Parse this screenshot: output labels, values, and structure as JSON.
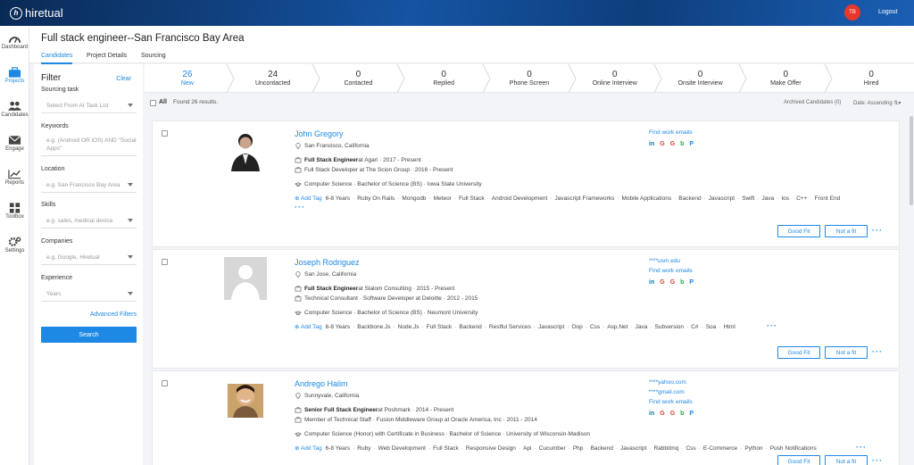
{
  "app": {
    "name": "hiretual",
    "avatar_initials": "TB",
    "logout": "Logout"
  },
  "nav": [
    {
      "label": "Dashboard",
      "icon": "dashboard-icon"
    },
    {
      "label": "Projects",
      "icon": "briefcase-icon"
    },
    {
      "label": "Candidates",
      "icon": "people-icon"
    },
    {
      "label": "Engage",
      "icon": "envelope-icon"
    },
    {
      "label": "Reports",
      "icon": "chart-icon"
    },
    {
      "label": "Toolbox",
      "icon": "grid-icon"
    },
    {
      "label": "Settings",
      "icon": "gear-icon"
    }
  ],
  "project": {
    "title": "Full stack engineer--San Francisco Bay Area",
    "tabs": [
      "Candidates",
      "Project Details",
      "Sourcing"
    ]
  },
  "filter": {
    "title": "Filter",
    "clear": "Clear",
    "fields": [
      {
        "label": "Sourcing task",
        "placeholder": "Select From AI Task List",
        "select": true
      },
      {
        "label": "Keywords",
        "placeholder": "e.g. (Android OR iOS) AND \"Social Apps\"",
        "select": false
      },
      {
        "label": "Location",
        "placeholder": "e.g. San Francisco Bay Area",
        "select": true
      },
      {
        "label": "Skills",
        "placeholder": "e.g. sales, medical device",
        "select": true
      },
      {
        "label": "Companies",
        "placeholder": "e.g. Google, Hiretual",
        "select": true
      },
      {
        "label": "Experience",
        "placeholder": "Years",
        "select": true
      }
    ],
    "advanced": "Advanced Filters",
    "search": "Search"
  },
  "pipeline": [
    {
      "count": "26",
      "label": "New"
    },
    {
      "count": "24",
      "label": "Uncontacted"
    },
    {
      "count": "0",
      "label": "Contacted"
    },
    {
      "count": "0",
      "label": "Replied"
    },
    {
      "count": "0",
      "label": "Phone Screen"
    },
    {
      "count": "0",
      "label": "Online Interview"
    },
    {
      "count": "0",
      "label": "Onsite Interview"
    },
    {
      "count": "0",
      "label": "Make Offer"
    },
    {
      "count": "0",
      "label": "Hired"
    }
  ],
  "results": {
    "all": "All",
    "found": "Found 26 results.",
    "archived": "Archived Candidates (0)",
    "sort": "Date: Ascending"
  },
  "candidates": [
    {
      "name": "John Gregory",
      "location": "San Francisco, California",
      "jobs": [
        {
          "title": "Full Stack Engineer",
          "rest": " at Agari · 2017 - Present"
        },
        {
          "title": "",
          "rest": "Full Stack Developer at The Scion Group · 2016 - Present"
        }
      ],
      "education": "Computer Science · Bachelor of Science (BS) · Iowa State University",
      "add_tag": "Add Tag",
      "tags": [
        "6-8 Years",
        "Ruby On Rails",
        "Mongodb",
        "Meteor",
        "Full Stack",
        "Android Development",
        "Javascript Frameworks",
        "Mobile Applications",
        "Backend",
        "Javascript",
        "Swift",
        "Java",
        "Ios",
        "C++",
        "Front End"
      ],
      "emails": [],
      "find_emails": "Find work emails",
      "good_fit": "Good Fit",
      "not_fit": "Not a fit"
    },
    {
      "name": "Joseph Rodriguez",
      "location": "San Jose, California",
      "jobs": [
        {
          "title": "Full Stack Engineer",
          "rest": " at Slalom Consulting · 2015 - Present"
        },
        {
          "title": "",
          "rest": "Technical Consultant · Software Developer at Deloitte · 2012 - 2015"
        }
      ],
      "education": "Computer Science · Bachelor of Science (BS) · Neumont University",
      "add_tag": "Add Tag",
      "tags": [
        "6-8 Years",
        "Backbone.Js",
        "Node.Js",
        "Full Stack",
        "Backend",
        "Restful Services",
        "Javascript",
        "Oop",
        "Css",
        "Asp.Net",
        "Java",
        "Subversion",
        "C#",
        "Soa",
        "Html"
      ],
      "emails": [
        "****usm.edu"
      ],
      "find_emails": "Find work emails",
      "good_fit": "Good Fit",
      "not_fit": "Not a fit"
    },
    {
      "name": "Andrego Halim",
      "location": "Sunnyvale, California",
      "jobs": [
        {
          "title": "Senior Full Stack Engineer",
          "rest": " at Poshmark · 2014 - Present"
        },
        {
          "title": "",
          "rest": "Member of Technical Staff · Fusion Middleware Group at Oracle America, Inc · 2011 - 2014"
        }
      ],
      "education": "Computer Science (Honor) with Certificate in Business · Bachelor of Science · University of Wisconsin-Madison",
      "add_tag": "Add Tag",
      "tags": [
        "6-8 Years",
        "Ruby",
        "Web Development",
        "Full Stack",
        "Responsive Design",
        "Api",
        "Cucumber",
        "Php",
        "Backend",
        "Javascript",
        "Rabbitmq",
        "Css",
        "E-Commerce",
        "Python",
        "Push Notifications"
      ],
      "emails": [
        "****yahoo.com",
        "****gmail.com"
      ],
      "find_emails": "Find work emails",
      "good_fit": "Good Fit",
      "not_fit": "Not a fit"
    }
  ],
  "social": [
    "in",
    "G",
    "G",
    "b",
    "P"
  ],
  "colors": {
    "accent": "#1e88e5",
    "linkedin": "#0e76a8",
    "google": "#db4437",
    "bing": "#2aa54b",
    "pinterest": "#1e88e5"
  }
}
